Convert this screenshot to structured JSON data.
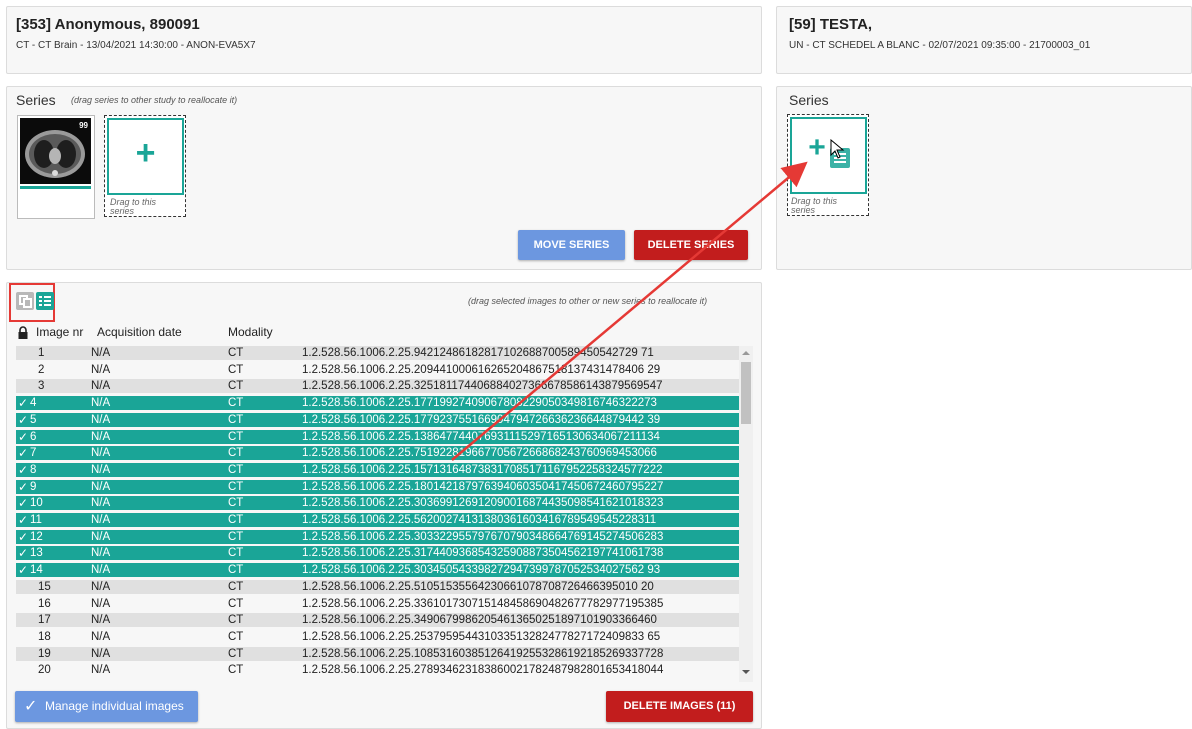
{
  "source_study": {
    "title": "[353] Anonymous, 890091",
    "subtitle": "CT - CT Brain - 13/04/2021 14:30:00 - ANON-EVA5X7",
    "series_label": "Series",
    "series_hint": "(drag series to other study to reallocate it)",
    "thumbnail_count": "99",
    "drop_text": "Drag to this series",
    "move_series_label": "MOVE SERIES",
    "delete_series_label": "DELETE SERIES"
  },
  "target_study": {
    "title": "[59] TESTA,",
    "subtitle": "UN - CT SCHEDEL A BLANC - 02/07/2021 09:35:00 - 21700003_01",
    "series_label": "Series",
    "drop_text": "Drag to this series"
  },
  "images": {
    "hint": "(drag selected images to other or new series to reallocate it)",
    "columns": [
      "Image nr",
      "Acquisition date",
      "Modality"
    ],
    "rows": [
      {
        "nr": "1",
        "date": "N/A",
        "modality": "CT",
        "uid": "1.2.528.56.1006.2.25.94212486182817102688700589450542729 71",
        "selected": false
      },
      {
        "nr": "2",
        "date": "N/A",
        "modality": "CT",
        "uid": "1.2.528.56.1006.2.25.209441000616265204867518137431478406 29",
        "selected": false
      },
      {
        "nr": "3",
        "date": "N/A",
        "modality": "CT",
        "uid": "1.2.528.56.1006.2.25.325181174406884027366678586143879569547",
        "selected": false
      },
      {
        "nr": "4",
        "date": "N/A",
        "modality": "CT",
        "uid": "1.2.528.56.1006.2.25.17719927409067808229050349816746322273",
        "selected": true
      },
      {
        "nr": "5",
        "date": "N/A",
        "modality": "CT",
        "uid": "1.2.528.56.1006.2.25.177923755166904794726636236644879442 39",
        "selected": true
      },
      {
        "nr": "6",
        "date": "N/A",
        "modality": "CT",
        "uid": "1.2.528.56.1006.2.25.138647744076931115297165130634067211134",
        "selected": true
      },
      {
        "nr": "7",
        "date": "N/A",
        "modality": "CT",
        "uid": "1.2.528.56.1006.2.25.75192281966770567266868243760969453066",
        "selected": true
      },
      {
        "nr": "8",
        "date": "N/A",
        "modality": "CT",
        "uid": "1.2.528.56.1006.2.25.157131648738317085171167952258324577222",
        "selected": true
      },
      {
        "nr": "9",
        "date": "N/A",
        "modality": "CT",
        "uid": "1.2.528.56.1006.2.25.180142187976394060350417450672460795227",
        "selected": true
      },
      {
        "nr": "10",
        "date": "N/A",
        "modality": "CT",
        "uid": "1.2.528.56.1006.2.25.303699126912090016874435098541621018323",
        "selected": true
      },
      {
        "nr": "11",
        "date": "N/A",
        "modality": "CT",
        "uid": "1.2.528.56.1006.2.25.56200274131380361603416789549545228311",
        "selected": true
      },
      {
        "nr": "12",
        "date": "N/A",
        "modality": "CT",
        "uid": "1.2.528.56.1006.2.25.303322955797670790348664769145274506283",
        "selected": true
      },
      {
        "nr": "13",
        "date": "N/A",
        "modality": "CT",
        "uid": "1.2.528.56.1006.2.25.317440936854325908873504562197741061738",
        "selected": true
      },
      {
        "nr": "14",
        "date": "N/A",
        "modality": "CT",
        "uid": "1.2.528.56.1006.2.25.303450543398272947399787052534027562 93",
        "selected": true
      },
      {
        "nr": "15",
        "date": "N/A",
        "modality": "CT",
        "uid": "1.2.528.56.1006.2.25.51051535564230661078708726466395010 20",
        "selected": false
      },
      {
        "nr": "16",
        "date": "N/A",
        "modality": "CT",
        "uid": "1.2.528.56.1006.2.25.336101730715148458690482677782977195385",
        "selected": false
      },
      {
        "nr": "17",
        "date": "N/A",
        "modality": "CT",
        "uid": "1.2.528.56.1006.2.25.34906799862054613650251897101903366460",
        "selected": false
      },
      {
        "nr": "18",
        "date": "N/A",
        "modality": "CT",
        "uid": "1.2.528.56.1006.2.25.253795954431033513282477827172409833 65",
        "selected": false
      },
      {
        "nr": "19",
        "date": "N/A",
        "modality": "CT",
        "uid": "1.2.528.56.1006.2.25.108531603851264192553286192185269337728",
        "selected": false
      },
      {
        "nr": "20",
        "date": "N/A",
        "modality": "CT",
        "uid": "1.2.528.56.1006.2.25.278934623183860021782487982801653418044",
        "selected": false
      }
    ],
    "manage_label": "Manage individual images",
    "delete_images_label": "DELETE IMAGES (11)"
  },
  "colors": {
    "teal": "#1aa597",
    "blue_button": "#6c97e0",
    "red_button": "#c21d1d",
    "highlight": "#e53935"
  }
}
